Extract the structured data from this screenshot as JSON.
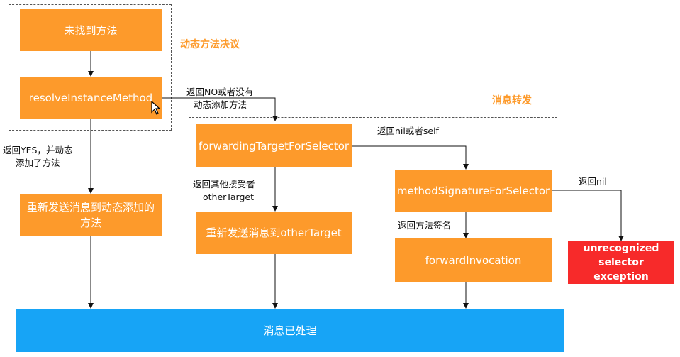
{
  "sections": {
    "dynamic_resolution": "动态方法决议",
    "message_forwarding": "消息转发"
  },
  "nodes": {
    "not_found": "未找到方法",
    "resolve_instance_method": "resolveInstanceMethod",
    "resend_dynamic_line1": "重新发送消息到动态添加的",
    "resend_dynamic_line2": "方法",
    "forwarding_target": "forwardingTargetForSelector",
    "resend_other": "重新发送消息到otherTarget",
    "method_signature": "methodSignatureForSelector",
    "forward_invocation": "forwardInvocation",
    "unrecognized_line1": "unrecognized",
    "unrecognized_line2": "selector exception",
    "handled": "消息已处理"
  },
  "edge_labels": {
    "yes_line1": "返回YES，并动态",
    "yes_line2": "添加了方法",
    "no_line1": "返回NO或者没有",
    "no_line2": "动态添加方法",
    "nil_self": "返回nil或者self",
    "other_line1": "返回其他接受者",
    "other_line2": "otherTarget",
    "return_nil": "返回nil",
    "signature": "返回方法签名"
  },
  "colors": {
    "process": "#fd9a2b",
    "exception": "#f72a2a",
    "terminal": "#17a4f6"
  }
}
